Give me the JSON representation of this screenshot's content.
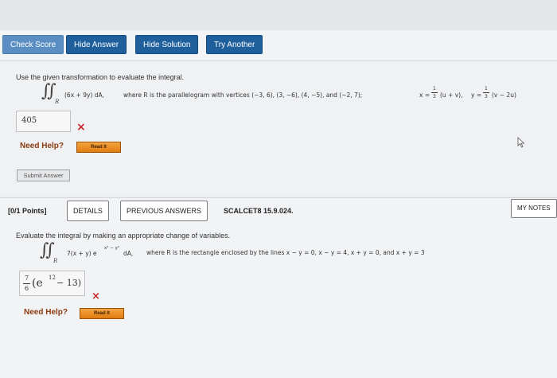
{
  "toolbar": {
    "check_score": "Check Score",
    "hide_answer": "Hide Answer",
    "hide_solution": "Hide Solution",
    "try_another": "Try Another"
  },
  "question1": {
    "instruction": "Use the given transformation to evaluate the integral.",
    "integral_symbol": "∬",
    "region": "R",
    "integrand": "(6x + 9y) dA,",
    "description": "where R is the parallelogram with vertices (−3, 6),  (3, −6),  (4, −5),  and  (−2, 7);",
    "transform_x": "x = ",
    "transform_x_frac_num": "1",
    "transform_x_frac_den": "3",
    "transform_x_expr": "(u + v),",
    "transform_y": "y = ",
    "transform_y_frac_num": "1",
    "transform_y_frac_den": "3",
    "transform_y_expr": "(v − 2u)",
    "answer": "405",
    "need_help": "Need Help?",
    "read_it": "Read It",
    "submit": "Submit Answer"
  },
  "question2": {
    "score": "[0/1 Points]",
    "details": "DETAILS",
    "previous_answers": "PREVIOUS ANSWERS",
    "code": "SCALCET8 15.9.024.",
    "my_notes": "MY NOTES",
    "instruction": "Evaluate the integral by making an appropriate change of variables.",
    "integral_symbol": "∬",
    "region": "R",
    "integrand": "7(x + y) e",
    "integrand_exp": "x² − y²",
    "integrand_tail": " dA,",
    "description": "where R is the rectangle enclosed by the lines  x − y = 0,  x − y = 4,  x + y = 0,  and  x + y = 3",
    "answer_num": "7",
    "answer_den": "6",
    "answer_open": "(e",
    "answer_exp": "12",
    "answer_close": " − 13)",
    "need_help": "Need Help?",
    "read_it": "Read It"
  },
  "colors": {
    "button_blue": "#1f5f9c",
    "wrong_mark": "#c8262e",
    "help_text": "#8a3b10",
    "read_it_orange": "#e89223"
  },
  "icons": {
    "wrong": "×",
    "cursor": "arrow-cursor-icon"
  }
}
